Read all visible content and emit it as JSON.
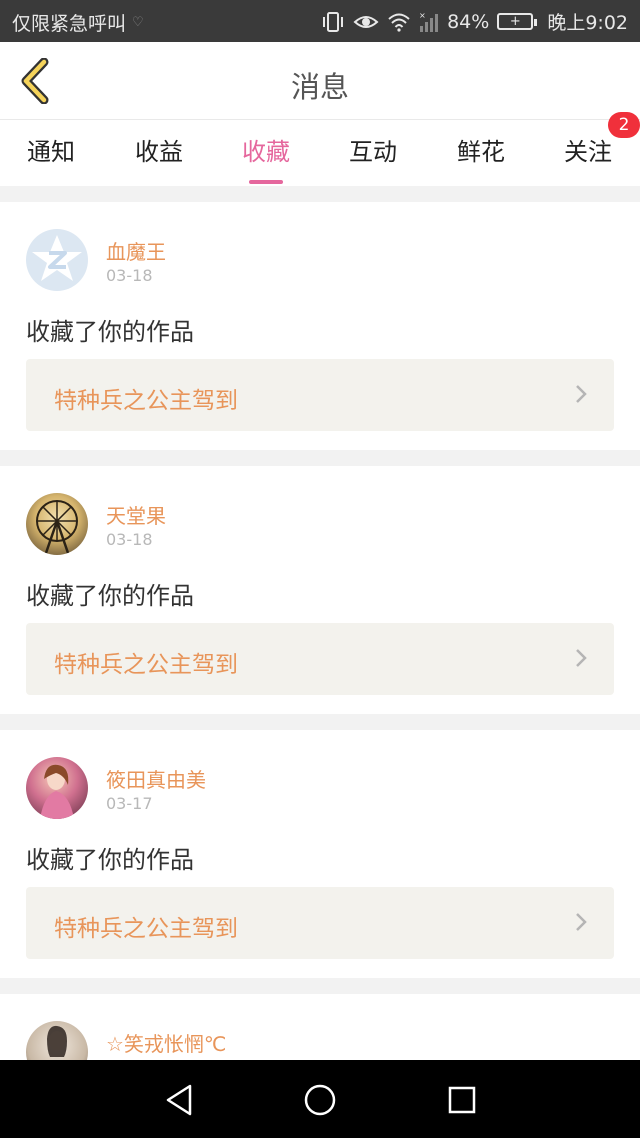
{
  "status_bar": {
    "carrier_text": "仅限紧急呼叫",
    "battery_percent": "84%",
    "time": "晚上9:02"
  },
  "header": {
    "title": "消息"
  },
  "tabs": [
    {
      "label": "通知",
      "active": false
    },
    {
      "label": "收益",
      "active": false
    },
    {
      "label": "收藏",
      "active": true
    },
    {
      "label": "互动",
      "active": false
    },
    {
      "label": "鲜花",
      "active": false
    },
    {
      "label": "关注",
      "active": false,
      "badge": "2"
    }
  ],
  "cards": [
    {
      "user": "血魔王",
      "date": "03-18",
      "action": "收藏了你的作品",
      "work": "特种兵之公主驾到"
    },
    {
      "user": "天堂果",
      "date": "03-18",
      "action": "收藏了你的作品",
      "work": "特种兵之公主驾到"
    },
    {
      "user": "筱田真由美",
      "date": "03-17",
      "action": "收藏了你的作品",
      "work": "特种兵之公主驾到"
    },
    {
      "user": "☆笑戎怅惘℃",
      "date": "",
      "action": "",
      "work": ""
    }
  ],
  "colors": {
    "accent": "#e5679d",
    "name": "#e8955a",
    "badge": "#f0303b"
  }
}
